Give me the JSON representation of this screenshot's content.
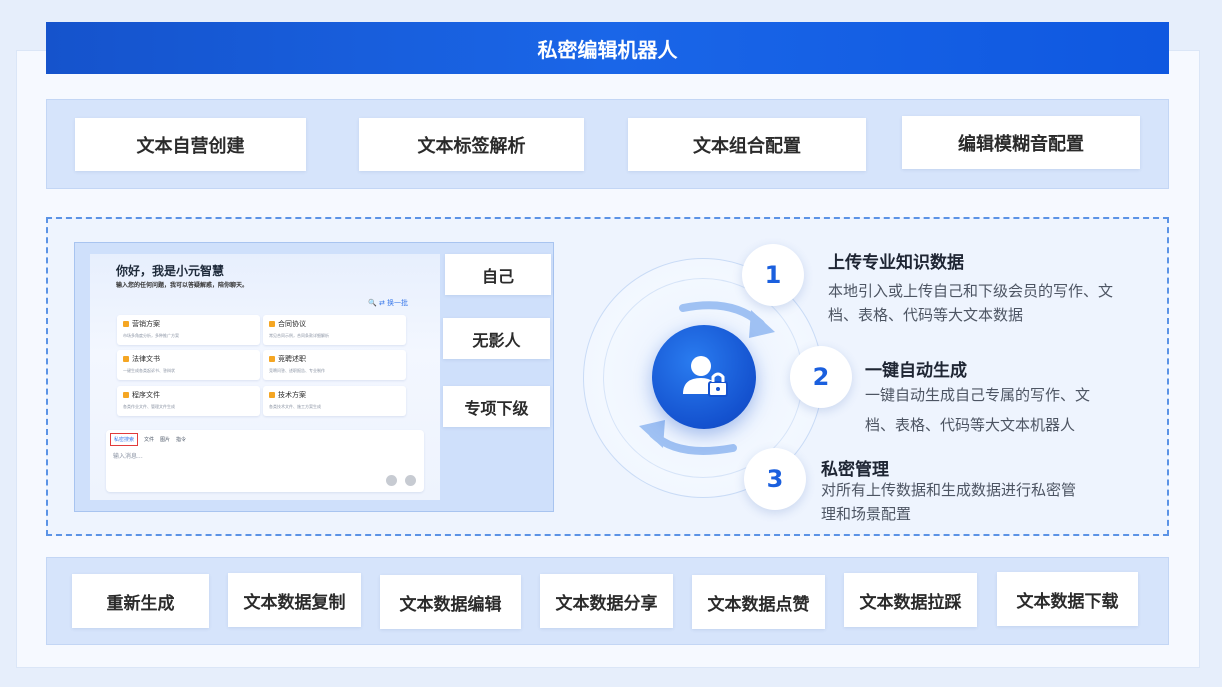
{
  "title": "私密编辑机器人",
  "top_features": [
    "文本自营创建",
    "文本标签解析",
    "文本组合配置",
    "编辑模糊音配置"
  ],
  "bottom_actions": [
    "重新生成",
    "文本数据复制",
    "文本数据编辑",
    "文本数据分享",
    "文本数据点赞",
    "文本数据拉踩",
    "文本数据下载"
  ],
  "side_options": [
    "自己",
    "无影人",
    "专项下级"
  ],
  "preview": {
    "greeting": "你好，我是小元智慧",
    "subtitle": "输入您的任何问题，我可以答疑解惑，陪你聊天。",
    "tools": "🔍 ⇄ 换一批",
    "cards": [
      {
        "title": "营销方案",
        "desc": "市场多角度分析，多种推广方案"
      },
      {
        "title": "合同协议",
        "desc": "常见合同示例，合同条款详细解析"
      },
      {
        "title": "法律文书",
        "desc": "一键生成各类起诉书、答辩状"
      },
      {
        "title": "竞聘述职",
        "desc": "竞聘问答、述职报告、专业制作"
      },
      {
        "title": "程序文件",
        "desc": "各类作业文件、管理文件生成"
      },
      {
        "title": "技术方案",
        "desc": "各类技术文件、施工方案生成"
      }
    ],
    "input_tabs": [
      "私密搜索",
      "文件",
      "图片",
      "指令"
    ],
    "input_placeholder": "输入消息..."
  },
  "steps": [
    {
      "num": "1",
      "title": "上传专业知识数据",
      "desc": [
        "本地引入或上传自己和下级会员的写作、文",
        "档、表格、代码等大文本数据"
      ]
    },
    {
      "num": "2",
      "title": "一键自动生成",
      "desc": [
        "一键自动生成自己专属的写作、文",
        "档、表格、代码等大文本机器人"
      ]
    },
    {
      "num": "3",
      "title": "私密管理",
      "desc": [
        "对所有上传数据和生成数据进行私密管",
        "理和场景配置"
      ]
    }
  ],
  "icons": {
    "center": "user-lock-icon"
  },
  "colors": {
    "accent": "#1a5fde",
    "title_bar": "#1553cc",
    "dashed": "#5b93e6"
  }
}
